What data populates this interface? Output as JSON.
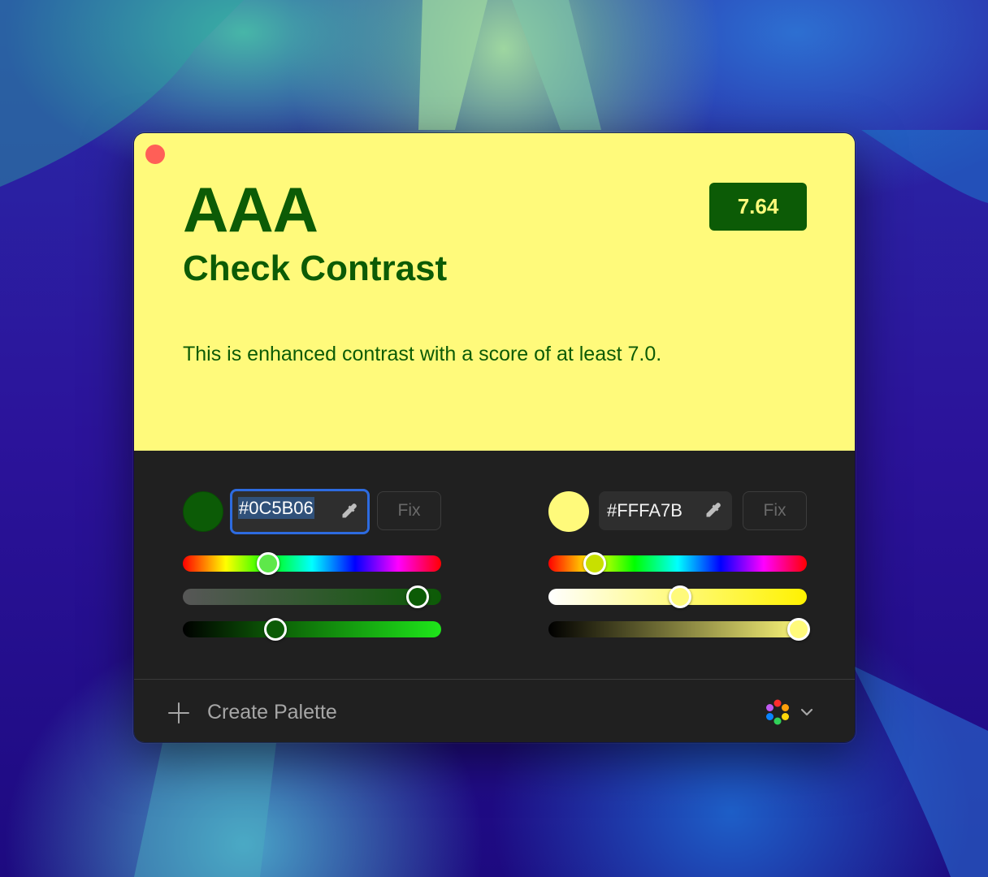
{
  "preview": {
    "level": "AAA",
    "title": "Check Contrast",
    "description": "This is enhanced contrast with a score of at least 7.0.",
    "score": "7.64"
  },
  "foreground": {
    "hex": "#0C5B06",
    "fix_label": "Fix",
    "color": "#0c5b06",
    "hue_position": 0.33,
    "saturation_position": 0.91,
    "lightness_position": 0.36
  },
  "background": {
    "hex": "#FFFA7B",
    "fix_label": "Fix",
    "color": "#fffa7b",
    "hue_position": 0.18,
    "saturation_position": 0.51,
    "lightness_position": 0.97
  },
  "footer": {
    "create_palette_label": "Create Palette"
  },
  "icons": {
    "close": "close-icon",
    "eyedropper": "eyedropper-icon",
    "swap": "swap-icon",
    "plus": "plus-icon",
    "color_wheel": "color-wheel-icon",
    "chevron": "chevron-down-icon"
  }
}
